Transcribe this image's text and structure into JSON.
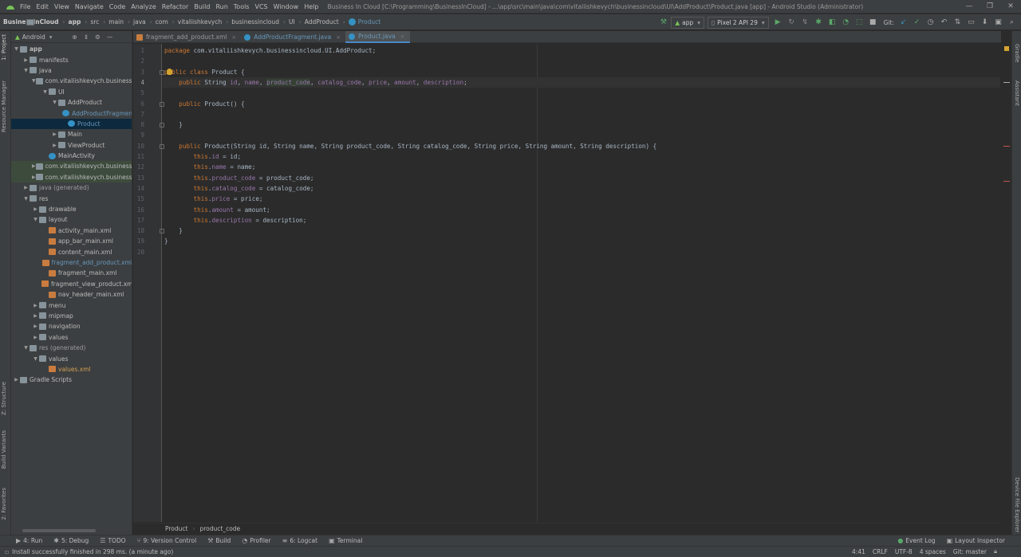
{
  "menu": {
    "items": [
      "File",
      "Edit",
      "View",
      "Navigate",
      "Code",
      "Analyze",
      "Refactor",
      "Build",
      "Run",
      "Tools",
      "VCS",
      "Window",
      "Help"
    ],
    "window_title": "Business In Cloud [C:\\Programming\\BusinessInCloud] - ...\\app\\src\\main\\java\\com\\vitaliishkevych\\businessincloud\\UI\\AddProduct\\Product.java [app] - Android Studio (Administrator)"
  },
  "window_controls": [
    "—",
    "❐",
    "✕"
  ],
  "breadcrumbs": [
    "BusinessInCloud",
    "app",
    "src",
    "main",
    "java",
    "com",
    "vitaliishkevych",
    "businessincloud",
    "UI",
    "AddProduct",
    "Product"
  ],
  "run": {
    "config": "app",
    "device": "Pixel 2 API 29",
    "git_label": "Git:"
  },
  "left_strip": {
    "project": "1: Project",
    "resource_manager": "Resource Manager",
    "structure": "Z: Structure",
    "build_variants": "Build Variants",
    "favorites": "2: Favorites"
  },
  "right_strip": {
    "gradle": "Gradle",
    "assistant": "Assistant",
    "device_file_explorer": "Device File Explorer"
  },
  "project_panel": {
    "view": "Android",
    "tree": [
      {
        "label": "app",
        "depth": 0,
        "icon": "folder",
        "expanded": true,
        "bold": true
      },
      {
        "label": "manifests",
        "depth": 1,
        "icon": "folder",
        "expanded": false
      },
      {
        "label": "java",
        "depth": 1,
        "icon": "folder",
        "expanded": true
      },
      {
        "label": "com.vitaliishkevych.businessinc",
        "depth": 2,
        "icon": "pkg",
        "expanded": true
      },
      {
        "label": "UI",
        "depth": 3,
        "icon": "pkg",
        "expanded": true
      },
      {
        "label": "AddProduct",
        "depth": 4,
        "icon": "pkg",
        "expanded": true
      },
      {
        "label": "AddProductFragmen",
        "depth": 5,
        "icon": "cls",
        "style": "blue"
      },
      {
        "label": "Product",
        "depth": 5,
        "icon": "cls",
        "style": "blue",
        "selected": true
      },
      {
        "label": "Main",
        "depth": 4,
        "icon": "pkg",
        "expanded": false
      },
      {
        "label": "ViewProduct",
        "depth": 4,
        "icon": "pkg",
        "expanded": false
      },
      {
        "label": "MainActivity",
        "depth": 3,
        "icon": "cls"
      },
      {
        "label": "com.vitaliishkevych.businessinc",
        "depth": 2,
        "icon": "pkg",
        "expanded": false,
        "tint": true
      },
      {
        "label": "com.vitaliishkevych.businessinc",
        "depth": 2,
        "icon": "pkg",
        "expanded": false,
        "tint": true
      },
      {
        "label": "java (generated)",
        "depth": 1,
        "icon": "folder",
        "expanded": false,
        "style": "gray"
      },
      {
        "label": "res",
        "depth": 1,
        "icon": "res",
        "expanded": true
      },
      {
        "label": "drawable",
        "depth": 2,
        "icon": "folder",
        "expanded": false
      },
      {
        "label": "layout",
        "depth": 2,
        "icon": "folder",
        "expanded": true
      },
      {
        "label": "activity_main.xml",
        "depth": 3,
        "icon": "xml"
      },
      {
        "label": "app_bar_main.xml",
        "depth": 3,
        "icon": "xml"
      },
      {
        "label": "content_main.xml",
        "depth": 3,
        "icon": "xml"
      },
      {
        "label": "fragment_add_product.xml",
        "depth": 3,
        "icon": "xml",
        "style": "blue"
      },
      {
        "label": "fragment_main.xml",
        "depth": 3,
        "icon": "xml"
      },
      {
        "label": "fragment_view_product.xml",
        "depth": 3,
        "icon": "xml"
      },
      {
        "label": "nav_header_main.xml",
        "depth": 3,
        "icon": "xml"
      },
      {
        "label": "menu",
        "depth": 2,
        "icon": "folder",
        "expanded": false
      },
      {
        "label": "mipmap",
        "depth": 2,
        "icon": "folder",
        "expanded": false
      },
      {
        "label": "navigation",
        "depth": 2,
        "icon": "folder",
        "expanded": false
      },
      {
        "label": "values",
        "depth": 2,
        "icon": "folder",
        "expanded": false
      },
      {
        "label": "res (generated)",
        "depth": 1,
        "icon": "res",
        "expanded": true,
        "style": "gray"
      },
      {
        "label": "values",
        "depth": 2,
        "icon": "folder",
        "expanded": true
      },
      {
        "label": "values.xml",
        "depth": 3,
        "icon": "xml",
        "style": "orange"
      },
      {
        "label": "Gradle Scripts",
        "depth": 0,
        "icon": "folder",
        "expanded": false
      }
    ]
  },
  "tabs": [
    {
      "label": "fragment_add_product.xml",
      "icon": "xml",
      "active": false
    },
    {
      "label": "AddProductFragment.java",
      "icon": "cls",
      "active": false
    },
    {
      "label": "Product.java",
      "icon": "cls",
      "active": true
    }
  ],
  "editor": {
    "current_line": 4,
    "lines": [
      [
        [
          "kw",
          "package "
        ],
        [
          "",
          "com.vitaliishkevych.businessincloud.UI.AddProduct;"
        ]
      ],
      [],
      [
        [
          "kw",
          "public class "
        ],
        [
          "",
          "Product {"
        ]
      ],
      [
        [
          "",
          "    "
        ],
        [
          "kw",
          "public "
        ],
        [
          "",
          "String "
        ],
        [
          "fld",
          "id"
        ],
        [
          "",
          ", "
        ],
        [
          "fld",
          "name"
        ],
        [
          "",
          ", "
        ],
        [
          "fld hl",
          "product_code"
        ],
        [
          "",
          ", "
        ],
        [
          "fld",
          "catalog_code"
        ],
        [
          "",
          ", "
        ],
        [
          "fld",
          "price"
        ],
        [
          "",
          ", "
        ],
        [
          "fld",
          "amount"
        ],
        [
          "",
          ", "
        ],
        [
          "fld",
          "description"
        ],
        [
          "",
          ";"
        ]
      ],
      [],
      [
        [
          "",
          "    "
        ],
        [
          "kw",
          "public "
        ],
        [
          "",
          "Product() {"
        ]
      ],
      [],
      [
        [
          "",
          "    }"
        ]
      ],
      [],
      [
        [
          "",
          "    "
        ],
        [
          "kw",
          "public "
        ],
        [
          "",
          "Product(String id, String name, String product_code, String catalog_code, String price, String amount, String description) {"
        ]
      ],
      [
        [
          "",
          "        "
        ],
        [
          "kw",
          "this"
        ],
        [
          "",
          "."
        ],
        [
          "fld",
          "id"
        ],
        [
          "",
          " = id;"
        ]
      ],
      [
        [
          "",
          "        "
        ],
        [
          "kw",
          "this"
        ],
        [
          "",
          "."
        ],
        [
          "fld",
          "name"
        ],
        [
          "",
          " = name;"
        ]
      ],
      [
        [
          "",
          "        "
        ],
        [
          "kw",
          "this"
        ],
        [
          "",
          "."
        ],
        [
          "fld",
          "product_code"
        ],
        [
          "",
          " = product_code;"
        ]
      ],
      [
        [
          "",
          "        "
        ],
        [
          "kw",
          "this"
        ],
        [
          "",
          "."
        ],
        [
          "fld",
          "catalog_code"
        ],
        [
          "",
          " = catalog_code;"
        ]
      ],
      [
        [
          "",
          "        "
        ],
        [
          "kw",
          "this"
        ],
        [
          "",
          "."
        ],
        [
          "fld",
          "price"
        ],
        [
          "",
          " = price;"
        ]
      ],
      [
        [
          "",
          "        "
        ],
        [
          "kw",
          "this"
        ],
        [
          "",
          "."
        ],
        [
          "fld",
          "amount"
        ],
        [
          "",
          " = amount;"
        ]
      ],
      [
        [
          "",
          "        "
        ],
        [
          "kw",
          "this"
        ],
        [
          "",
          "."
        ],
        [
          "fld",
          "description"
        ],
        [
          "",
          " = description;"
        ]
      ],
      [
        [
          "",
          "    }"
        ]
      ],
      [
        [
          "",
          "}"
        ]
      ],
      []
    ]
  },
  "editor_breadcrumb": [
    "Product",
    "product_code"
  ],
  "tool_windows": {
    "left": [
      "4: Run",
      "5: Debug",
      "TODO",
      "9: Version Control",
      "Build",
      "Profiler",
      "6: Logcat",
      "Terminal"
    ],
    "right": [
      "Event Log",
      "Layout Inspector"
    ]
  },
  "status": {
    "message": "Install successfully finished in 298 ms. (a minute ago)",
    "position": "4:41",
    "line_sep": "CRLF",
    "encoding": "UTF-8",
    "indent": "4 spaces",
    "git": "Git: master"
  },
  "colors": {
    "background": "#2b2b2b",
    "panel": "#3c3f41",
    "keyword": "#cc7832",
    "field": "#9876aa",
    "text": "#a9b7c6",
    "selection": "#0d293e",
    "accent": "#4a88c7"
  }
}
